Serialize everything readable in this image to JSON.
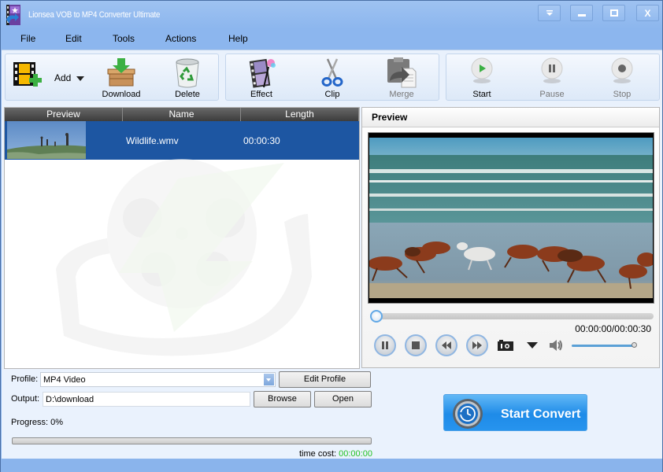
{
  "window": {
    "title": "Lionsea VOB to MP4 Converter Ultimate",
    "controls": [
      "help-dropdown",
      "minimize",
      "maximize",
      "close"
    ],
    "close_label": "X"
  },
  "menu": {
    "items": [
      "File",
      "Edit",
      "Tools",
      "Actions",
      "Help"
    ]
  },
  "toolbar": {
    "add": "Add",
    "download": "Download",
    "delete": "Delete",
    "effect": "Effect",
    "clip": "Clip",
    "merge": "Merge",
    "start": "Start",
    "pause": "Pause",
    "stop": "Stop"
  },
  "file_list": {
    "columns": [
      "Preview",
      "Name",
      "Length"
    ],
    "rows": [
      {
        "name": "Wildlife.wmv",
        "length": "00:00:30",
        "selected": true
      }
    ]
  },
  "preview": {
    "title": "Preview",
    "time": "00:00:00/00:00:30",
    "seek_position": 0,
    "volume": 1.0
  },
  "settings": {
    "profile_label": "Profile:",
    "profile_value": "MP4 Video",
    "edit_profile": "Edit Profile",
    "output_label": "Output:",
    "output_value": "D:\\download",
    "browse": "Browse",
    "open": "Open",
    "progress_label": "Progress: 0%",
    "progress_value": 0,
    "time_cost_label": "time cost:",
    "time_cost_value": "00:00:00"
  },
  "convert": {
    "label": "Start Convert"
  },
  "colors": {
    "selection": "#1d56a2",
    "accent_blue": "#1e8be8",
    "time_green": "#25c225",
    "frame_blue": "#8ab4ec"
  }
}
